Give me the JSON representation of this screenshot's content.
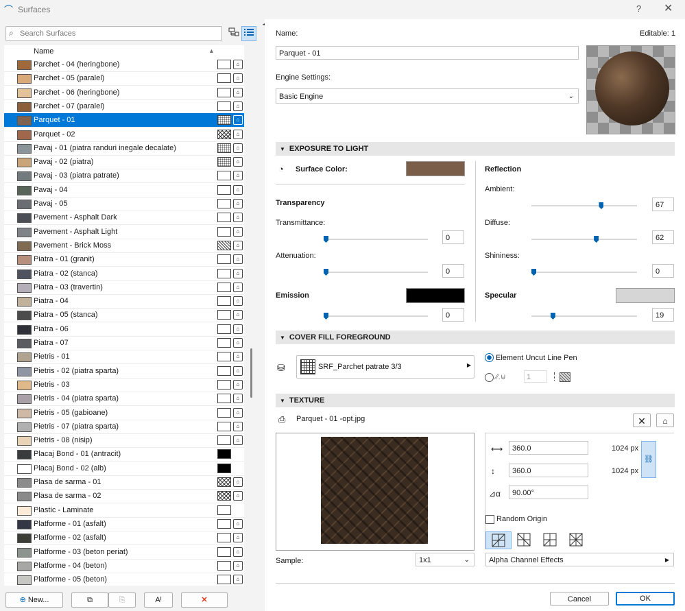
{
  "window": {
    "title": "Surfaces",
    "help": "?",
    "close": "✕"
  },
  "search": {
    "placeholder": "Search Surfaces"
  },
  "list": {
    "column_name": "Name",
    "items": [
      {
        "name": "Parchet - 04 (heringbone)",
        "color": "#a0693c",
        "fill": "empty"
      },
      {
        "name": "Parchet - 05 (paralel)",
        "color": "#d9a97a",
        "fill": "empty"
      },
      {
        "name": "Parchet - 06 (heringbone)",
        "color": "#e3c29a",
        "fill": "empty"
      },
      {
        "name": "Parchet - 07 (paralel)",
        "color": "#8b5e3c",
        "fill": "empty"
      },
      {
        "name": "Parquet - 01",
        "color": "#7d6350",
        "fill": "pat2",
        "selected": true
      },
      {
        "name": "Parquet - 02",
        "color": "#a0674a",
        "fill": "pat4"
      },
      {
        "name": "Pavaj - 01 (piatra randuri inegale decalate)",
        "color": "#8a9499",
        "fill": "pat2"
      },
      {
        "name": "Pavaj - 02 (piatra)",
        "color": "#cba57a",
        "fill": "pat2"
      },
      {
        "name": "Pavaj - 03 (piatra patrate)",
        "color": "#737b7e",
        "fill": "empty"
      },
      {
        "name": "Pavaj - 04",
        "color": "#596459",
        "fill": "empty"
      },
      {
        "name": "Pavaj - 05",
        "color": "#6a6d72",
        "fill": "empty"
      },
      {
        "name": "Pavement - Asphalt Dark",
        "color": "#4b4e55",
        "fill": "empty"
      },
      {
        "name": "Pavement - Asphalt Light",
        "color": "#808488",
        "fill": "empty"
      },
      {
        "name": "Pavement - Brick Moss",
        "color": "#816a52",
        "fill": "pat3"
      },
      {
        "name": "Piatra - 01 (granit)",
        "color": "#b88e7c",
        "fill": "empty"
      },
      {
        "name": "Piatra - 02 (stanca)",
        "color": "#4f5360",
        "fill": "empty"
      },
      {
        "name": "Piatra - 03 (travertin)",
        "color": "#b3aeb8",
        "fill": "empty"
      },
      {
        "name": "Piatra - 04",
        "color": "#c1b29c",
        "fill": "empty"
      },
      {
        "name": "Piatra - 05 (stanca)",
        "color": "#4c4c4c",
        "fill": "empty"
      },
      {
        "name": "Piatra - 06",
        "color": "#2f3038",
        "fill": "empty"
      },
      {
        "name": "Piatra - 07",
        "color": "#5b5b62",
        "fill": "empty"
      },
      {
        "name": "Pietris - 01",
        "color": "#b0a490",
        "fill": "empty"
      },
      {
        "name": "Pietris - 02 (piatra sparta)",
        "color": "#8f95a3",
        "fill": "empty"
      },
      {
        "name": "Pietris - 03",
        "color": "#dfb98a",
        "fill": "empty"
      },
      {
        "name": "Pietris - 04 (piatra sparta)",
        "color": "#a8a0a6",
        "fill": "empty"
      },
      {
        "name": "Pietris - 05 (gabioane)",
        "color": "#cdb9a5",
        "fill": "empty"
      },
      {
        "name": "Pietris - 07 (piatra sparta)",
        "color": "#b1b0b0",
        "fill": "empty"
      },
      {
        "name": "Pietris - 08 (nisip)",
        "color": "#e8d3b7",
        "fill": "empty"
      },
      {
        "name": "Placaj Bond - 01 (antracit)",
        "color": "#3a3b3d",
        "fill": "black",
        "noicon": true
      },
      {
        "name": "Placaj Bond - 02 (alb)",
        "color": "#ffffff",
        "fill": "black",
        "noicon": true
      },
      {
        "name": "Plasa de sarma - 01",
        "color": "#8b8b8b",
        "fill": "pat4"
      },
      {
        "name": "Plasa de sarma - 02",
        "color": "#8a8a8a",
        "fill": "pat4"
      },
      {
        "name": "Plastic - Laminate",
        "color": "#fcecd7",
        "fill": "empty",
        "noicon": true
      },
      {
        "name": "Platforme - 01 (asfalt)",
        "color": "#333645",
        "fill": "empty"
      },
      {
        "name": "Platforme - 02 (asfalt)",
        "color": "#3d3d38",
        "fill": "empty"
      },
      {
        "name": "Platforme - 03 (beton periat)",
        "color": "#8d9490",
        "fill": "empty"
      },
      {
        "name": "Platforme - 04 (beton)",
        "color": "#a7a7a5",
        "fill": "empty"
      },
      {
        "name": "Platforme - 05 (beton)",
        "color": "#c6c6c3",
        "fill": "empty"
      }
    ]
  },
  "footer": {
    "new_label": "New...",
    "delete_symbol": "✕"
  },
  "detail": {
    "name_label": "Name:",
    "editable": "Editable: 1",
    "name_value": "Parquet - 01",
    "engine_label": "Engine Settings:",
    "engine_value": "Basic Engine",
    "exposure_title": "EXPOSURE TO LIGHT",
    "surface_color_label": "Surface Color:",
    "surface_color": "#7a5e4a",
    "transparency_label": "Transparency",
    "transmittance_label": "Transmittance:",
    "transmittance_value": "0",
    "transmittance_level": 0,
    "attenuation_label": "Attenuation:",
    "attenuation_value": "0",
    "attenuation_level": 0,
    "emission_label": "Emission",
    "emission_color": "#000000",
    "emission_value": "0",
    "emission_level": 0,
    "reflection_label": "Reflection",
    "ambient_label": "Ambient:",
    "ambient_value": "67",
    "ambient_level": 0.67,
    "diffuse_label": "Diffuse:",
    "diffuse_value": "62",
    "diffuse_level": 0.62,
    "shininess_label": "Shininess:",
    "shininess_value": "0",
    "shininess_level": 0,
    "specular_label": "Specular",
    "specular_color": "#d6d6d6",
    "specular_value": "19",
    "specular_level": 0.19,
    "cover_title": "COVER FILL FOREGROUND",
    "cover_fill_name": "SRF_Parchet patrate 3/3",
    "element_pen_label": "Element Uncut Line Pen",
    "pen_number": "1",
    "texture_title": "TEXTURE",
    "texture_file": "Parquet - 01 -opt.jpg",
    "width_value": "360.0",
    "height_value": "360.0",
    "width_px": "1024 px",
    "height_px": "1024 px",
    "angle_value": "90.00°",
    "random_origin_label": "Random Origin",
    "sample_label": "Sample:",
    "sample_value": "1x1",
    "alpha_label": "Alpha Channel Effects",
    "cancel_label": "Cancel",
    "ok_label": "OK"
  }
}
